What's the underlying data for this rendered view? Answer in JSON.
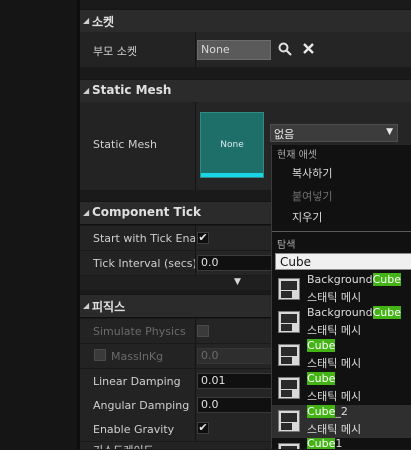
{
  "sections": {
    "socket": {
      "title": "소켓",
      "parent_socket_label": "부모 소켓",
      "parent_socket_value": "None"
    },
    "static_mesh": {
      "title": "Static Mesh",
      "label": "Static Mesh",
      "thumbnail_text": "None",
      "combo_value": "없음"
    },
    "component_tick": {
      "title": "Component Tick",
      "start_with_tick_label": "Start with Tick Enab",
      "tick_interval_label": "Tick Interval (secs)",
      "tick_interval_value": "0.0"
    },
    "physics": {
      "title": "피직스",
      "simulate_label": "Simulate Physics",
      "mass_label": "MassInKg",
      "mass_value": "0.0",
      "linear_damping_label": "Linear Damping",
      "linear_damping_value": "0.01",
      "angular_damping_label": "Angular Damping",
      "angular_damping_value": "0.0",
      "enable_gravity_label": "Enable Gravity",
      "partial_next_label": "기스드레이드"
    }
  },
  "dropdown": {
    "current_asset_header": "현재 애셋",
    "copy": "복사하기",
    "paste": "붙여넣기",
    "clear": "지우기",
    "search_header": "탐색",
    "search_value": "Cube",
    "results": [
      {
        "pre": "Background",
        "hl": "Cube",
        "post": "",
        "type": "스태틱 메시"
      },
      {
        "pre": "Background",
        "hl": "Cube",
        "post": "",
        "type": "스태틱 메시"
      },
      {
        "pre": "",
        "hl": "Cube",
        "post": "",
        "type": "스태틱 메시"
      },
      {
        "pre": "",
        "hl": "Cube",
        "post": "",
        "type": "스태틱 메시"
      },
      {
        "pre": "",
        "hl": "Cube",
        "post": "_2",
        "type": "스태틱 메시"
      },
      {
        "pre": "",
        "hl": "Cube",
        "post": "1",
        "type": ""
      }
    ]
  },
  "colors": {
    "accent_cyan": "#18d6e6",
    "thumbnail_bg": "#1e6f6a",
    "match_highlight": "#44b315"
  },
  "icons": [
    "search-icon",
    "clear-x-icon",
    "chevron-down-icon",
    "expand-arrow-icon",
    "static-mesh-asset-icon"
  ]
}
